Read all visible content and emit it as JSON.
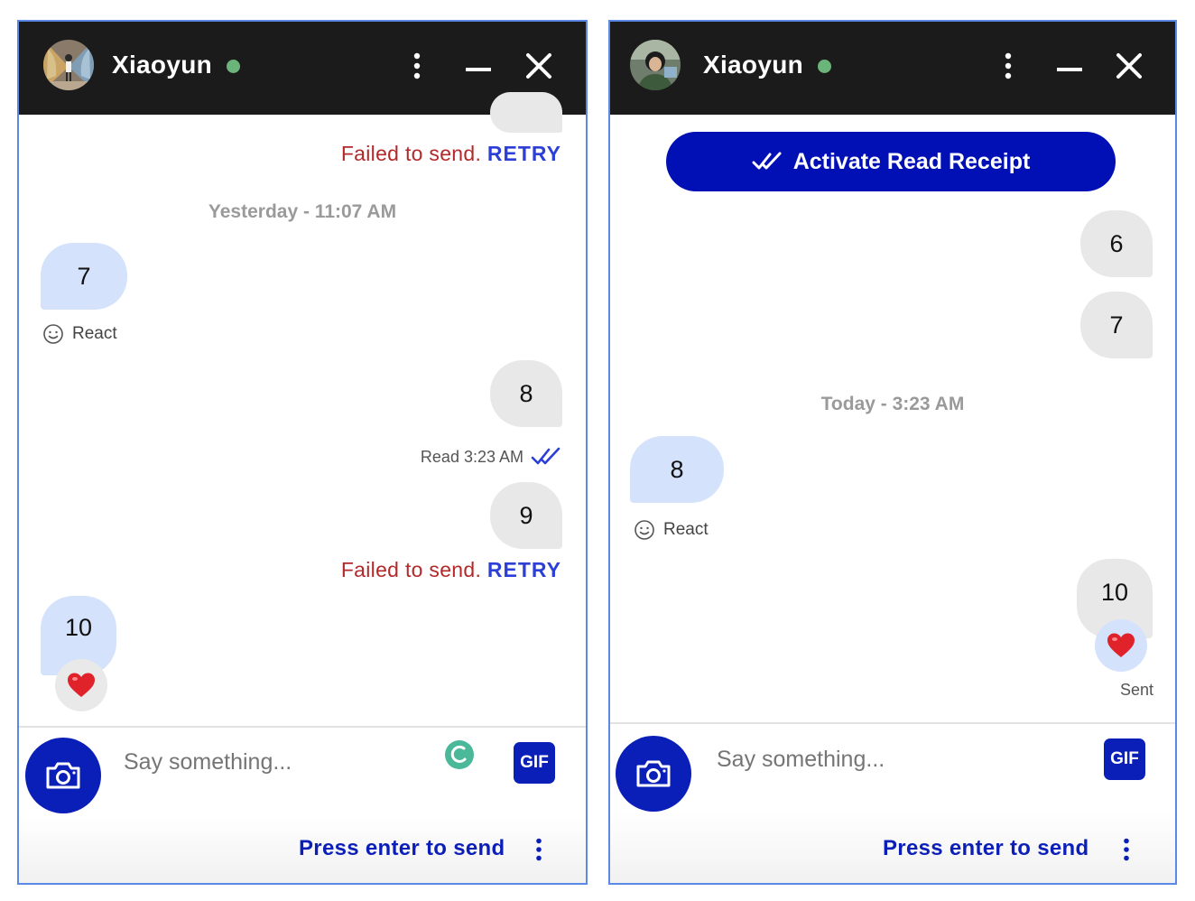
{
  "left_panel": {
    "header": {
      "name": "Xiaoyun",
      "status_color": "#6bb57b"
    },
    "failed_1": {
      "text": "Failed to send.",
      "retry": "RETRY"
    },
    "timestamp": "Yesterday - 11:07 AM",
    "msg_7": "7",
    "react_label": "React",
    "msg_8": "8",
    "read_status": "Read 3:23 AM",
    "msg_9": "9",
    "failed_2": {
      "text": "Failed to send.",
      "retry": "RETRY"
    },
    "msg_10": "10",
    "reaction": "heart",
    "footer": {
      "placeholder": "Say something...",
      "gif": "GIF",
      "press_enter": "Press enter to send"
    }
  },
  "right_panel": {
    "header": {
      "name": "Xiaoyun",
      "status_color": "#6bb57b"
    },
    "activate_button": "Activate Read Receipt",
    "msg_6": "6",
    "msg_7": "7",
    "timestamp": "Today - 3:23 AM",
    "msg_8": "8",
    "react_label": "React",
    "msg_10": "10",
    "reaction": "heart",
    "sent_label": "Sent",
    "footer": {
      "placeholder": "Say something...",
      "gif": "GIF",
      "press_enter": "Press enter to send"
    }
  },
  "colors": {
    "accent": "#0a1fb8",
    "failed": "#b3292a",
    "retry": "#2c3fd6",
    "their_bubble": "#d4e2fc",
    "my_bubble": "#e8e8e8",
    "header": "#1b1b1b",
    "frame": "#5b8ae6"
  }
}
